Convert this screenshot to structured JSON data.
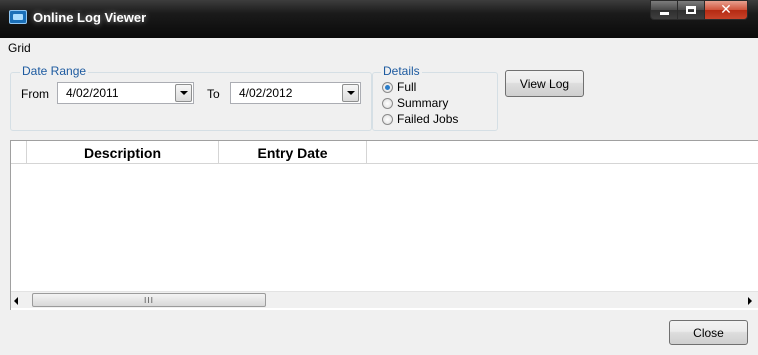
{
  "window": {
    "title": "Online Log Viewer",
    "icon": "app-icon",
    "caption_buttons": [
      "minimize",
      "maximize",
      "close"
    ]
  },
  "menu": {
    "items": [
      "Grid"
    ]
  },
  "date_range": {
    "legend": "Date Range",
    "from_label": "From",
    "from_value": "4/02/2011",
    "to_label": "To",
    "to_value": "4/02/2012"
  },
  "details": {
    "legend": "Details",
    "options": [
      {
        "label": "Full",
        "checked": true
      },
      {
        "label": "Summary",
        "checked": false
      },
      {
        "label": "Failed Jobs",
        "checked": false
      }
    ]
  },
  "buttons": {
    "view_log": "View Log",
    "close": "Close"
  },
  "grid": {
    "columns": [
      "Description",
      "Entry Date"
    ],
    "rows": [],
    "scroll_grip": "III"
  },
  "colors": {
    "legend_text": "#1e5ba0",
    "titlebar": "#0a0a0a",
    "close_button": "#c8432a"
  }
}
